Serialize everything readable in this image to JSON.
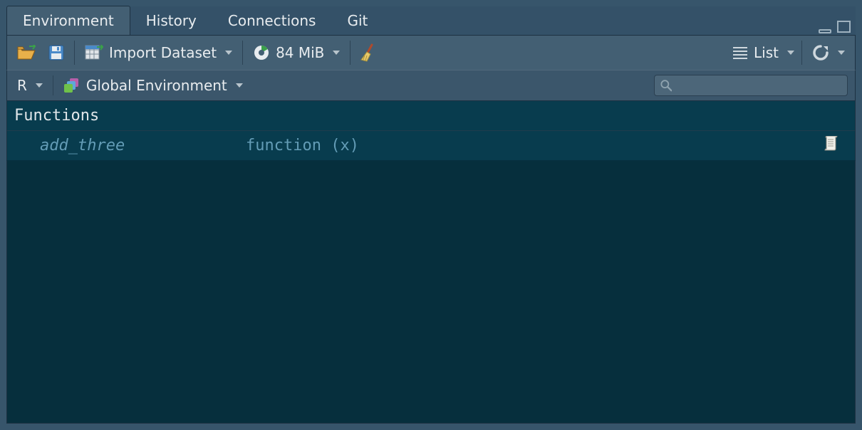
{
  "tabs": [
    {
      "label": "Environment",
      "active": true
    },
    {
      "label": "History",
      "active": false
    },
    {
      "label": "Connections",
      "active": false
    },
    {
      "label": "Git",
      "active": false
    }
  ],
  "toolbar": {
    "import_label": "Import Dataset",
    "memory_label": "84 MiB",
    "view_mode_label": "List"
  },
  "secondary": {
    "language_label": "R",
    "scope_label": "Global Environment"
  },
  "search": {
    "value": "",
    "placeholder": ""
  },
  "section": {
    "title": "Functions"
  },
  "items": [
    {
      "name": "add_three",
      "value": "function (x)"
    }
  ]
}
